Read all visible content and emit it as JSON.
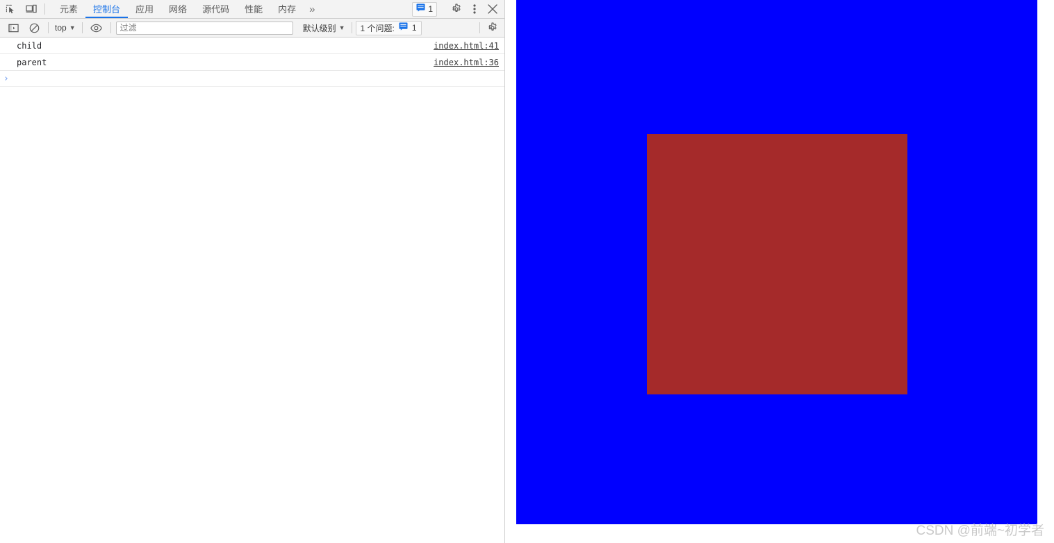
{
  "devtools": {
    "left_icons": [
      {
        "name": "inspect-element-icon",
        "title": "检查元素"
      },
      {
        "name": "device-toolbar-icon",
        "title": "设备工具栏"
      }
    ],
    "tabs": [
      {
        "id": "elements",
        "label": "元素",
        "active": false
      },
      {
        "id": "console",
        "label": "控制台",
        "active": true
      },
      {
        "id": "application",
        "label": "应用",
        "active": false
      },
      {
        "id": "network",
        "label": "网络",
        "active": false
      },
      {
        "id": "sources",
        "label": "源代码",
        "active": false
      },
      {
        "id": "performance",
        "label": "性能",
        "active": false
      },
      {
        "id": "memory",
        "label": "内存",
        "active": false
      }
    ],
    "tab_overflow_label": "»",
    "issue_badge": {
      "icon": "message-icon",
      "count": "1"
    },
    "settings_icon": "gear-icon",
    "more_icon": "more-vertical-icon",
    "close_icon": "close-icon",
    "toolbar": {
      "sidebar_toggle_icon": "console-sidebar-icon",
      "clear_console_icon": "clear-console-icon",
      "context_label": "top",
      "live_expression_icon": "eye-icon",
      "filter_placeholder": "过滤",
      "filter_value": "",
      "level_label": "默认级别",
      "problems_label": "1 个问题:",
      "problems_count": "1",
      "problems_icon": "message-icon",
      "console_settings_icon": "gear-icon"
    },
    "messages": [
      {
        "text": "child",
        "source": "index.html:41"
      },
      {
        "text": "parent",
        "source": "index.html:36"
      }
    ],
    "prompt": {
      "caret": "›",
      "value": "",
      "placeholder": ""
    }
  },
  "viewport": {
    "outer_color": "#0000ff",
    "inner_color": "#a52a2a",
    "watermark": "CSDN @前端~初学者"
  }
}
